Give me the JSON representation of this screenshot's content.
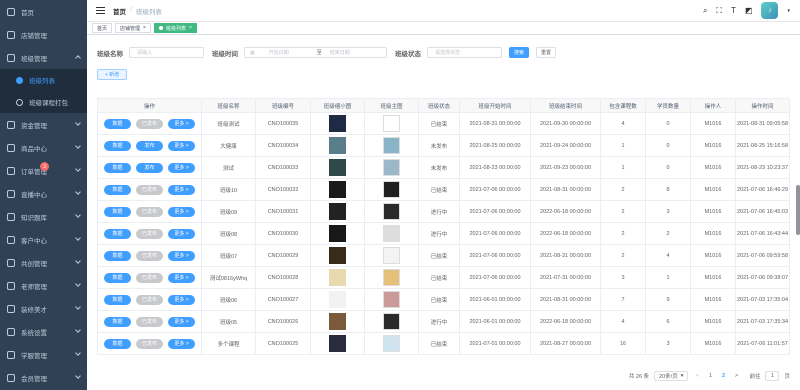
{
  "sidebar": {
    "items": [
      {
        "label": "首页",
        "icon": "home-icon",
        "arrow": false
      },
      {
        "label": "店铺管理",
        "icon": "shop-icon",
        "arrow": false
      },
      {
        "label": "班级管理",
        "icon": "class-icon",
        "arrow": true,
        "open": true
      },
      {
        "label": "资金管理",
        "icon": "money-icon",
        "arrow": true
      },
      {
        "label": "商品中心",
        "icon": "goods-icon",
        "arrow": true
      },
      {
        "label": "订单管理",
        "icon": "order-icon",
        "arrow": true,
        "badge": "3"
      },
      {
        "label": "直播中心",
        "icon": "live-icon",
        "arrow": true
      },
      {
        "label": "知识题库",
        "icon": "question-bank-icon",
        "arrow": true
      },
      {
        "label": "客户中心",
        "icon": "customer-icon",
        "arrow": true
      },
      {
        "label": "共创管理",
        "icon": "cocreate-icon",
        "arrow": true
      },
      {
        "label": "老师管理",
        "icon": "teacher-icon",
        "arrow": true
      },
      {
        "label": "装修美才",
        "icon": "decorate-icon",
        "arrow": true
      },
      {
        "label": "系统设置",
        "icon": "settings-icon",
        "arrow": true
      },
      {
        "label": "学服管理",
        "icon": "study-service-icon",
        "arrow": true
      },
      {
        "label": "会员管理",
        "icon": "member-icon",
        "arrow": true
      }
    ],
    "subitems": [
      {
        "label": "班级列表",
        "active": true
      },
      {
        "label": "班级课程打包",
        "active": false
      }
    ]
  },
  "navbar": {
    "crumb_home": "首页",
    "crumb_sep": "/",
    "crumb_current": "班级列表"
  },
  "tags": [
    {
      "label": "首页"
    },
    {
      "label": "店铺管理",
      "close": "×"
    },
    {
      "label": "班级列表",
      "close": "×",
      "active": true
    }
  ],
  "filters": {
    "name_label": "班级名称",
    "name_placeholder": "请输入",
    "time_label": "班级时间",
    "start_placeholder": "开始日期",
    "range_sep": "至",
    "end_placeholder": "结束日期",
    "status_label": "班级状态",
    "status_placeholder": "请选择状态",
    "search": "搜索",
    "reset": "重置",
    "add": "+ 新增"
  },
  "table": {
    "headers": [
      "操作",
      "班级名称",
      "班级编号",
      "班级缩小图",
      "班级主图",
      "班级状态",
      "班级开始时间",
      "班级结束时间",
      "包含课程数",
      "学员数量",
      "操作人",
      "操作时间"
    ],
    "btn_data": "数据",
    "btn_more": "更多 >",
    "rows": [
      {
        "pub": "已发布",
        "name": "班级测试",
        "code": "CNO100035",
        "status": "已结束",
        "start": "2021-08-31 00:00:00",
        "end": "2021-09-30 00:00:00",
        "courses": "4",
        "students": "0",
        "op": "M1016",
        "time": "2021-08-31 09:05:58"
      },
      {
        "pub": "发布",
        "name": "大健康",
        "code": "CNO100034",
        "status": "未发布",
        "start": "2021-08-25 00:00:00",
        "end": "2021-09-24 00:00:00",
        "courses": "1",
        "students": "0",
        "op": "M1016",
        "time": "2021-08-25 15:16:58"
      },
      {
        "pub": "发布",
        "name": "测试",
        "code": "CNO100033",
        "status": "未发布",
        "start": "2021-08-23 00:00:00",
        "end": "2021-09-23 00:00:00",
        "courses": "1",
        "students": "0",
        "op": "M1016",
        "time": "2021-08-23 10:23:37"
      },
      {
        "pub": "已发布",
        "name": "班级10",
        "code": "CNO100032",
        "status": "已结束",
        "start": "2021-07-06 00:00:00",
        "end": "2021-08-31 00:00:00",
        "courses": "2",
        "students": "8",
        "op": "M1016",
        "time": "2021-07-06 16:46:29"
      },
      {
        "pub": "已发布",
        "name": "班级09",
        "code": "CNO100031",
        "status": "进行中",
        "start": "2021-07-06 00:00:00",
        "end": "2022-06-18 00:00:00",
        "courses": "2",
        "students": "3",
        "op": "M1016",
        "time": "2021-07-06 16:45:03"
      },
      {
        "pub": "已发布",
        "name": "班级08",
        "code": "CNO100030",
        "status": "进行中",
        "start": "2021-07-06 00:00:00",
        "end": "2022-06-18 00:00:00",
        "courses": "2",
        "students": "2",
        "op": "M1016",
        "time": "2021-07-06 16:43:44"
      },
      {
        "pub": "已发布",
        "name": "班级07",
        "code": "CNO100029",
        "status": "已结束",
        "start": "2021-07-06 00:00:00",
        "end": "2021-08-31 00:00:00",
        "courses": "2",
        "students": "4",
        "op": "M1016",
        "time": "2021-07-06 09:59:58"
      },
      {
        "pub": "已发布",
        "name": "测试0816yWhq",
        "code": "CNO100028",
        "status": "已结束",
        "start": "2021-07-06 00:00:00",
        "end": "2021-07-31 00:00:00",
        "courses": "3",
        "students": "1",
        "op": "M1016",
        "time": "2021-07-06 09:38:07"
      },
      {
        "pub": "已发布",
        "name": "班级06",
        "code": "CNO100027",
        "status": "已结束",
        "start": "2021-06-01 00:00:00",
        "end": "2021-08-31 00:00:00",
        "courses": "7",
        "students": "9",
        "op": "M1016",
        "time": "2021-07-03 17:35:04"
      },
      {
        "pub": "已发布",
        "name": "班级05",
        "code": "CNO100026",
        "status": "进行中",
        "start": "2021-06-01 00:00:00",
        "end": "2022-06-18 00:00:00",
        "courses": "4",
        "students": "6",
        "op": "M1016",
        "time": "2021-07-03 17:35:34"
      },
      {
        "pub": "已发布",
        "name": "多个课程",
        "code": "CNO100025",
        "status": "已结束",
        "start": "2021-07-01 00:00:00",
        "end": "2021-08-27 00:00:00",
        "courses": "16",
        "students": "3",
        "op": "M1016",
        "time": "2021-07-06 11:01:57"
      }
    ]
  },
  "pagination": {
    "total": "共 26 条",
    "page_size": "20条/页",
    "prev": "<",
    "pages": [
      "1",
      "2"
    ],
    "current": "2",
    "next": ">",
    "goto_label": "前往",
    "goto_value": "1",
    "page_unit": "页"
  },
  "colors": {
    "primary": "#409eff",
    "sidebar_bg": "#304156",
    "tag_active": "#42b983"
  }
}
